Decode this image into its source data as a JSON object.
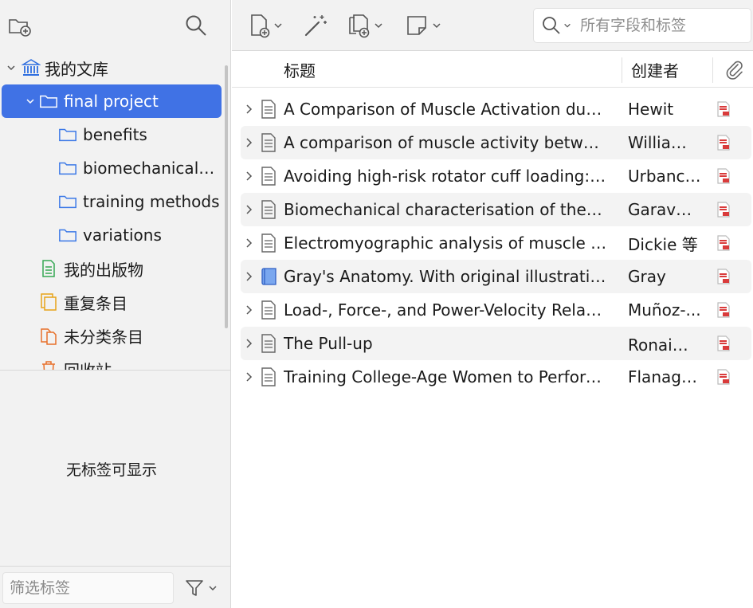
{
  "left_toolbar": {
    "new_collection_icon": "folder-plus-icon",
    "search_icon": "search-icon"
  },
  "collections": {
    "library": {
      "label": "我的文库",
      "icon": "library-icon"
    },
    "selected": {
      "label": "final project"
    },
    "subcollections": [
      {
        "label": "benefits"
      },
      {
        "label": "biomechanical f..."
      },
      {
        "label": "training methods"
      },
      {
        "label": "variations"
      }
    ],
    "special": [
      {
        "label": "我的出版物",
        "icon": "publications-icon"
      },
      {
        "label": "重复条目",
        "icon": "duplicates-icon"
      },
      {
        "label": "未分类条目",
        "icon": "unfiled-icon"
      },
      {
        "label": "回收站",
        "icon": "trash-icon"
      }
    ]
  },
  "tags": {
    "empty_message": "无标签可显示",
    "filter_placeholder": "筛选标签"
  },
  "main_toolbar": {
    "search_placeholder": "所有字段和标签"
  },
  "columns": {
    "title": "标题",
    "creator": "创建者"
  },
  "items": [
    {
      "title": "A Comparison of Muscle Activation durin...",
      "creator": "Hewit",
      "type": "journal-article"
    },
    {
      "title": "A comparison of muscle activity between ...",
      "creator": "William...",
      "type": "journal-article"
    },
    {
      "title": "Avoiding high-risk rotator cuff loading: M...",
      "creator": "Urbancz...",
      "type": "journal-article"
    },
    {
      "title": "Biomechanical characterisation of the pull...",
      "creator": "Garavag...",
      "type": "journal-article"
    },
    {
      "title": "Electromyographic analysis of muscle acti...",
      "creator": "Dickie 等",
      "type": "journal-article"
    },
    {
      "title": "Gray's Anatomy. With original illustrations...",
      "creator": "Gray",
      "type": "book"
    },
    {
      "title": "Load-, Force-, and Power-Velocity Relatio...",
      "creator": "Muñoz-...",
      "type": "journal-article"
    },
    {
      "title": "The Pull-up",
      "creator": "Ronai和...",
      "type": "journal-article"
    },
    {
      "title": "Training College-Age Women to Perform ...",
      "creator": "Flanaga...",
      "type": "journal-article"
    }
  ],
  "colors": {
    "selection": "#4072e5",
    "folder": "#3b78e7",
    "pdf": "#d93b3b"
  }
}
